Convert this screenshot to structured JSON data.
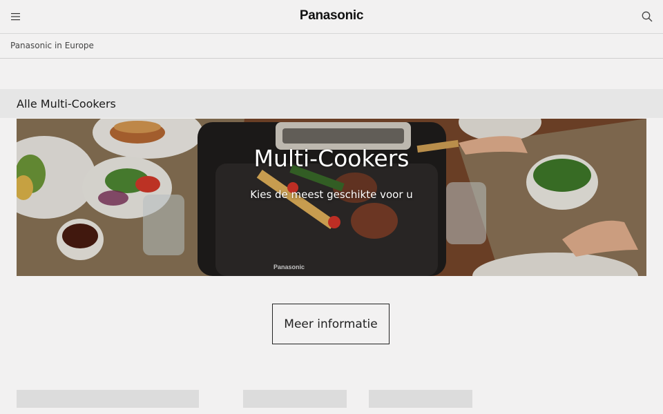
{
  "header": {
    "logo": "Panasonic",
    "menu_icon": "hamburger-menu-icon",
    "search_icon": "search-icon"
  },
  "breadcrumb": {
    "label": "Panasonic in Europe"
  },
  "section": {
    "title": "Alle Multi-Cookers"
  },
  "hero": {
    "title": "Multi-Cookers",
    "subtitle": "Kies de meest geschikte voor u"
  },
  "cta": {
    "label": "Meer informatie"
  },
  "colors": {
    "background": "#f2f1f1",
    "section_bar": "#e6e6e6",
    "placeholder": "#dcdcdc",
    "text": "#222222"
  }
}
